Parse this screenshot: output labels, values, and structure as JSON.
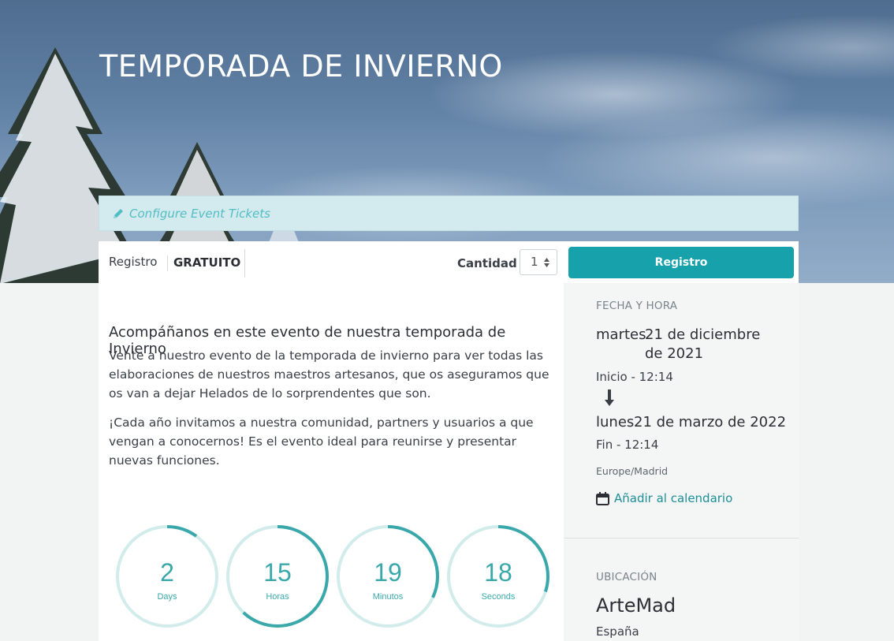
{
  "event": {
    "title": "TEMPORADA DE INVIERNO"
  },
  "config_bar": {
    "label": "Configure Event Tickets",
    "icon": "pencil-icon"
  },
  "ticket": {
    "name": "Registro",
    "price": "GRATUITO",
    "quantity_label": "Cantidad",
    "quantity_value": "1",
    "register_button": "Registro"
  },
  "description": {
    "title": "Acompáñanos en este evento de nuestra temporada de Invierno",
    "paragraphs": [
      "Vente a nuestro evento de la temporada de invierno para ver todas las elaboraciones de nuestros maestros artesanos, que os aseguramos que os van a dejar Helados de lo sorprendentes que son.",
      "¡Cada año invitamos a nuestra comunidad, partners y usuarios a que vengan a conocernos! Es el evento ideal para reunirse y presentar nuevas funciones."
    ]
  },
  "countdown": [
    {
      "value": "2",
      "unit": "Days",
      "progress": 0.1
    },
    {
      "value": "15",
      "unit": "Horas",
      "progress": 0.62
    },
    {
      "value": "19",
      "unit": "Minutos",
      "progress": 0.32
    },
    {
      "value": "18",
      "unit": "Seconds",
      "progress": 0.3
    }
  ],
  "date_time": {
    "label": "FECHA Y HORA",
    "start_day": "martes",
    "start_date_line1": "21 de diciembre",
    "start_date_line2": "de 2021",
    "start_time": "Inicio - 12:14",
    "end_day": "lunes",
    "end_date": "21 de marzo de 2022",
    "end_time": "Fin - 12:14",
    "timezone": "Europe/Madrid",
    "calendar_link": "Añadir al calendario"
  },
  "location": {
    "label": "UBICACIÓN",
    "name": "ArteMad",
    "country": "España"
  },
  "colors": {
    "accent": "#17a2ab",
    "countdown_ring": "#3aa8aa",
    "countdown_track": "#d2ecec",
    "config_bar_bg": "#d3ebee"
  }
}
